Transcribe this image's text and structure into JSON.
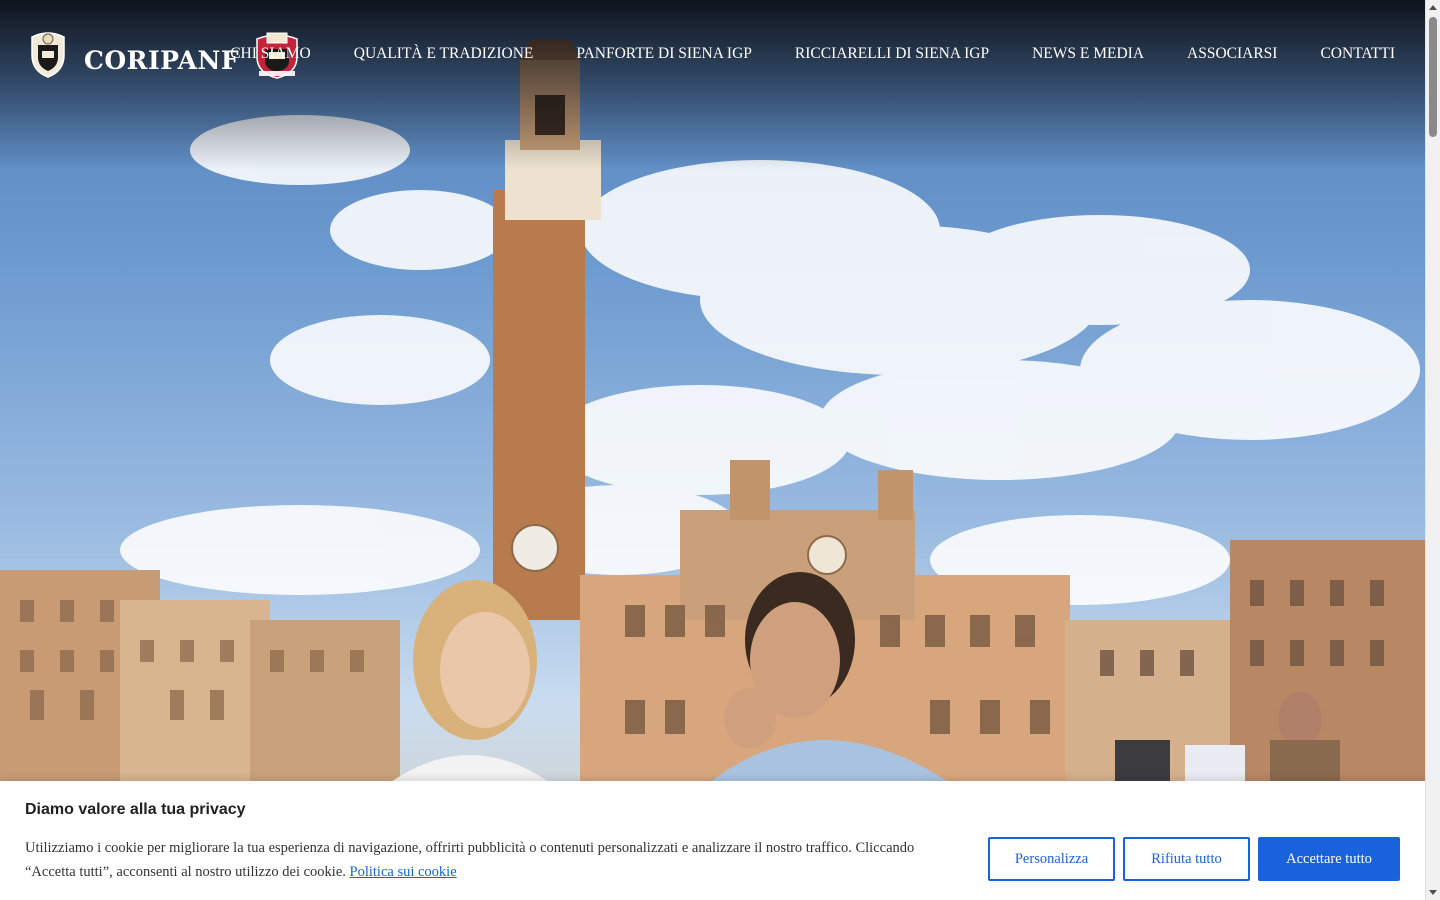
{
  "header": {
    "logo_text": "CORIPANF",
    "nav": [
      "CHI SIAMO",
      "QUALITÀ E TRADIZIONE",
      "PANFORTE DI SIENA IGP",
      "RICCIARELLI DI SIENA IGP",
      "NEWS E MEDIA",
      "ASSOCIARSI",
      "CONTATTI"
    ]
  },
  "cookie_banner": {
    "title": "Diamo valore alla tua privacy",
    "text": "Utilizziamo i cookie per migliorare la tua esperienza di navigazione, offrirti pubblicità o contenuti personalizzati e analizzare il nostro traffico. Cliccando “Accetta tutti”, acconsenti al nostro utilizzo dei cookie.",
    "policy_link": "Politica sui cookie",
    "buttons": {
      "customize": "Personalizza",
      "reject": "Rifiuta tutto",
      "accept": "Accettare tutto"
    }
  },
  "colors": {
    "accent": "#1863dc",
    "nav_text": "#ffffff"
  },
  "icons": {
    "logo_left": "crest-shield-icon",
    "logo_right": "crest-emblem-icon"
  }
}
